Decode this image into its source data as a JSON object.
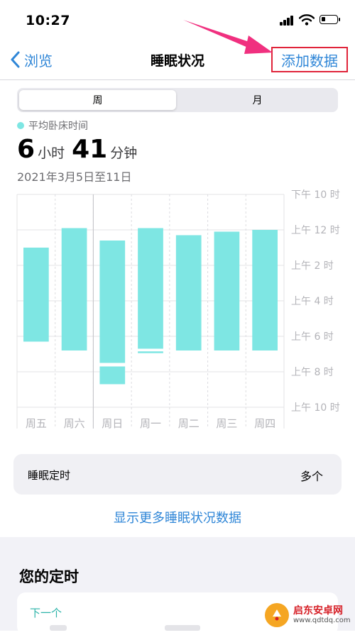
{
  "status_bar": {
    "time": "10:27"
  },
  "nav": {
    "back_label": "浏览",
    "title": "睡眠状况",
    "add_label": "添加数据"
  },
  "segmented": {
    "week_label": "周",
    "month_label": "月"
  },
  "summary": {
    "legend_label": "平均卧床时间",
    "hours": "6",
    "hours_unit": "小时",
    "minutes": "41",
    "minutes_unit": "分钟",
    "date_range": "2021年3月5日至11日"
  },
  "colors": {
    "bar": "#7ee6e3",
    "accent": "#2f86d7",
    "highlight_border": "#e0243a",
    "arrow": "#f0307f"
  },
  "chart_data": {
    "type": "bar",
    "series_kind": "floating range (bed time to wake time)",
    "categories": [
      "周五",
      "周六",
      "周日",
      "周一",
      "周二",
      "周三",
      "周四"
    ],
    "y_tick_labels": [
      "下午 10 时",
      "上午 12 时",
      "上午 2 时",
      "上午 4 时",
      "上午 6 时",
      "上午 8 时",
      "上午 10 时"
    ],
    "y_unit": "hours after 下午 10 时",
    "ylim": [
      0,
      12
    ],
    "segments": [
      {
        "category": "周五",
        "start": 3.0,
        "end": 8.3
      },
      {
        "category": "周六",
        "start": 1.9,
        "end": 8.8
      },
      {
        "category": "周日",
        "start": 2.6,
        "end": 9.5
      },
      {
        "category": "周日",
        "start": 9.7,
        "end": 10.7
      },
      {
        "category": "周一",
        "start": 1.9,
        "end": 8.7
      },
      {
        "category": "周一",
        "start": 8.85,
        "end": 8.95
      },
      {
        "category": "周二",
        "start": 2.3,
        "end": 8.8
      },
      {
        "category": "周三",
        "start": 2.1,
        "end": 8.8
      },
      {
        "category": "周四",
        "start": 2.0,
        "end": 8.8
      }
    ],
    "grid": true
  },
  "card": {
    "label": "睡眠定时",
    "value": "多个"
  },
  "more_link": "显示更多睡眠状况数据",
  "section": {
    "title": "您的定时",
    "next_label": "下一个"
  },
  "watermark": {
    "brand": "启东安卓网",
    "url": "www.qdtdq.com"
  }
}
